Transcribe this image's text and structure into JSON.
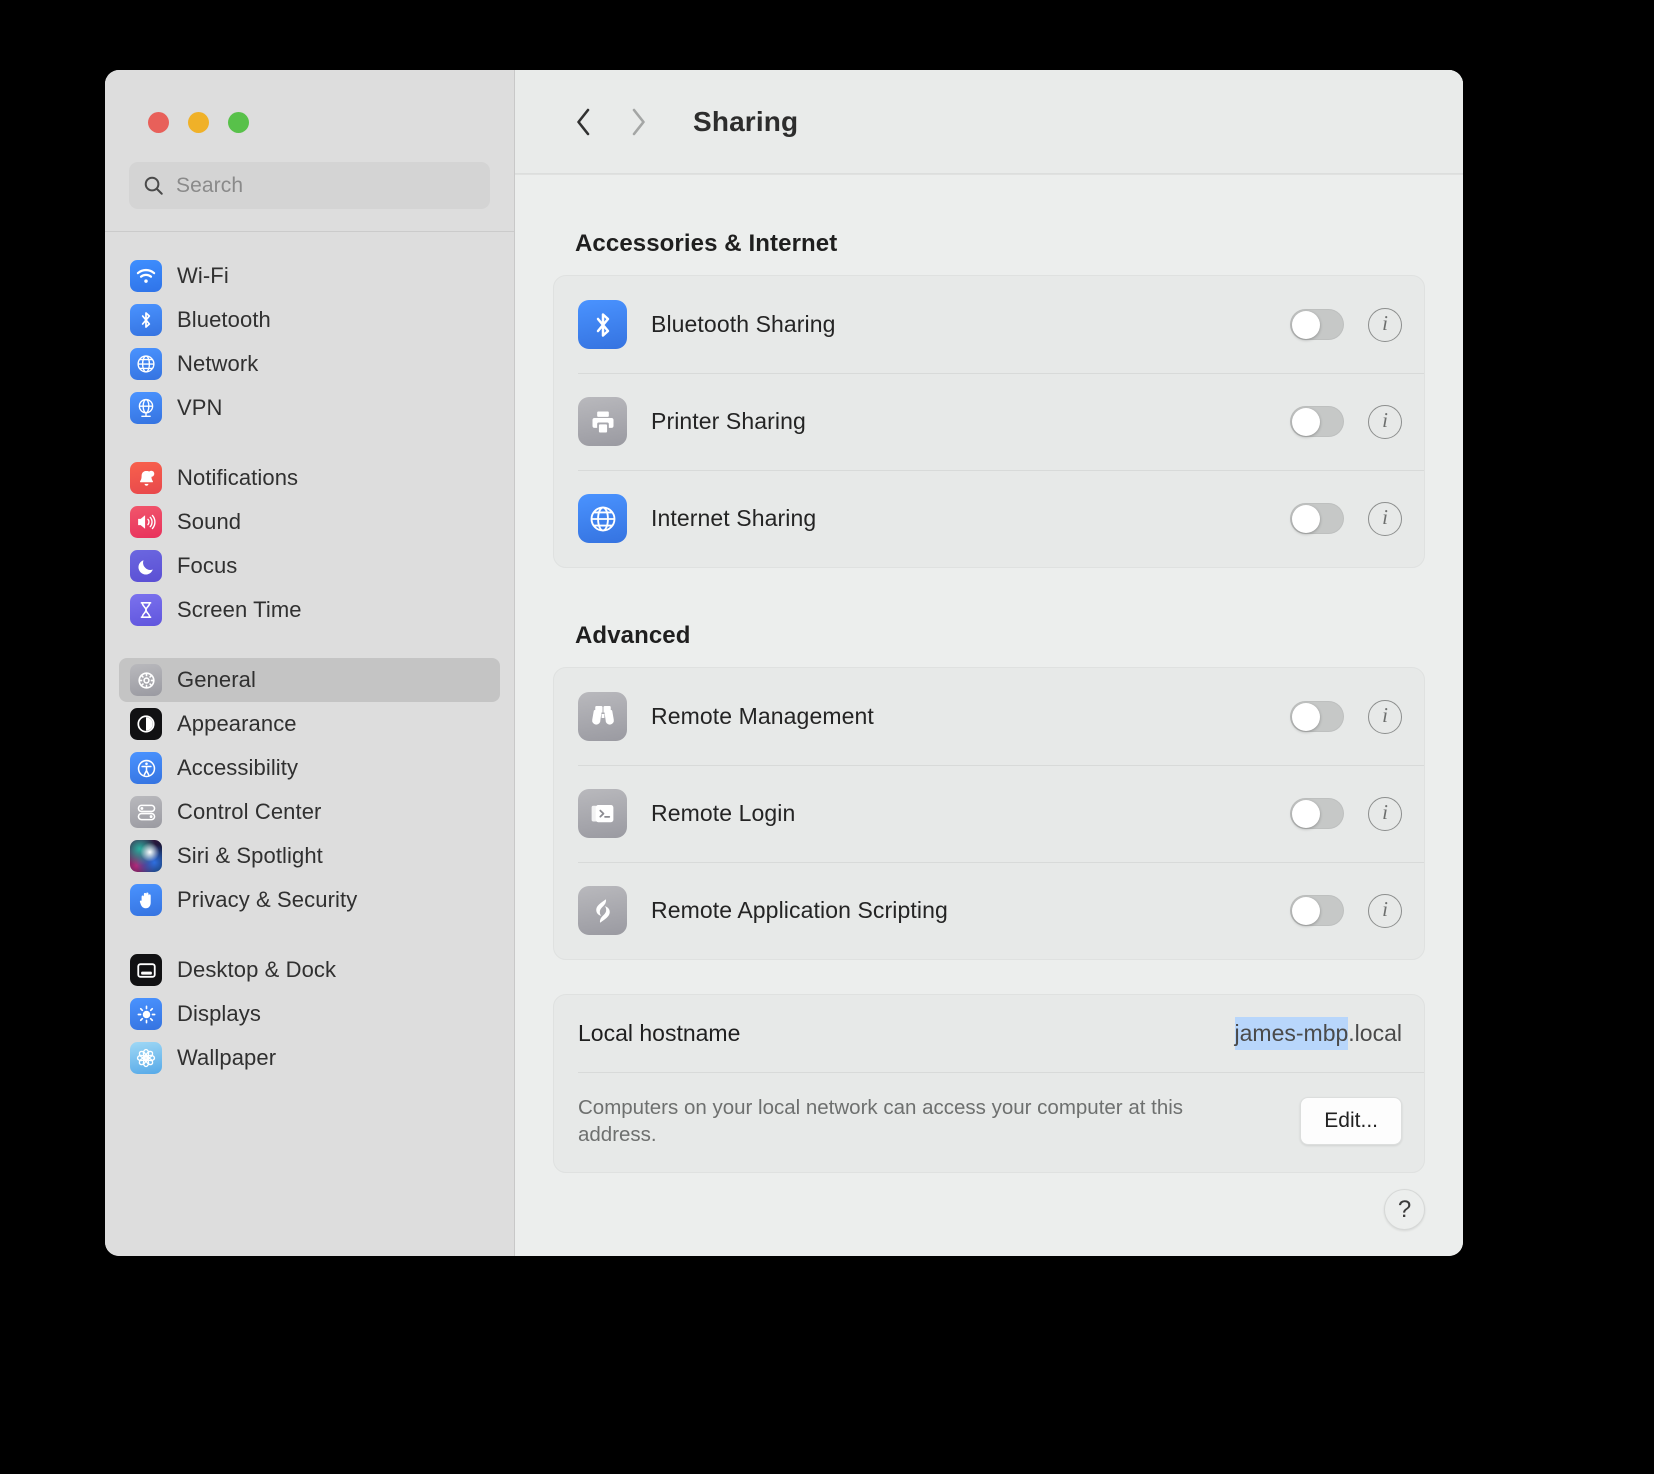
{
  "window": {
    "traffic_lights": [
      "close",
      "minimize",
      "maximize"
    ],
    "colors": {
      "close": "#e8605a",
      "minimize": "#f0b128",
      "maximize": "#58c14a",
      "selection_highlight": "#b8d6fb",
      "sidebar_bg": "#dddddd",
      "content_bg": "#eceeed",
      "accent_blue": "#3e8fff"
    }
  },
  "search": {
    "placeholder": "Search",
    "value": "",
    "icon": "search-icon"
  },
  "sidebar": {
    "groups": [
      {
        "items": [
          {
            "label": "Wi-Fi",
            "icon": "wifi-icon",
            "selected": false
          },
          {
            "label": "Bluetooth",
            "icon": "bluetooth-icon",
            "selected": false
          },
          {
            "label": "Network",
            "icon": "globe-icon",
            "selected": false
          },
          {
            "label": "VPN",
            "icon": "vpn-globe-icon",
            "selected": false
          }
        ]
      },
      {
        "items": [
          {
            "label": "Notifications",
            "icon": "bell-icon",
            "selected": false
          },
          {
            "label": "Sound",
            "icon": "speaker-icon",
            "selected": false
          },
          {
            "label": "Focus",
            "icon": "moon-icon",
            "selected": false
          },
          {
            "label": "Screen Time",
            "icon": "hourglass-icon",
            "selected": false
          }
        ]
      },
      {
        "items": [
          {
            "label": "General",
            "icon": "gear-icon",
            "selected": true
          },
          {
            "label": "Appearance",
            "icon": "appearance-icon",
            "selected": false
          },
          {
            "label": "Accessibility",
            "icon": "accessibility-icon",
            "selected": false
          },
          {
            "label": "Control Center",
            "icon": "control-center-icon",
            "selected": false
          },
          {
            "label": "Siri & Spotlight",
            "icon": "siri-icon",
            "selected": false
          },
          {
            "label": "Privacy & Security",
            "icon": "hand-icon",
            "selected": false
          }
        ]
      },
      {
        "items": [
          {
            "label": "Desktop & Dock",
            "icon": "desktop-dock-icon",
            "selected": false
          },
          {
            "label": "Displays",
            "icon": "brightness-icon",
            "selected": false
          },
          {
            "label": "Wallpaper",
            "icon": "wallpaper-icon",
            "selected": false
          }
        ]
      }
    ]
  },
  "toolbar": {
    "back_icon": "chevron-left-icon",
    "forward_icon": "chevron-right-icon",
    "title": "Sharing"
  },
  "main": {
    "sections": [
      {
        "title": "Accessories & Internet",
        "rows": [
          {
            "label": "Bluetooth Sharing",
            "icon": "bluetooth-icon",
            "icon_style": "blue",
            "toggle": "off",
            "info": "i"
          },
          {
            "label": "Printer Sharing",
            "icon": "printer-icon",
            "icon_style": "gray",
            "toggle": "off",
            "info": "i"
          },
          {
            "label": "Internet Sharing",
            "icon": "globe-icon",
            "icon_style": "blue",
            "toggle": "off",
            "info": "i"
          }
        ]
      },
      {
        "title": "Advanced",
        "rows": [
          {
            "label": "Remote Management",
            "icon": "binoculars-icon",
            "icon_style": "gray",
            "toggle": "off",
            "info": "i"
          },
          {
            "label": "Remote Login",
            "icon": "terminal-icon",
            "icon_style": "gray",
            "toggle": "off",
            "info": "i"
          },
          {
            "label": "Remote Application Scripting",
            "icon": "script-icon",
            "icon_style": "gray",
            "toggle": "off",
            "info": "i"
          }
        ]
      }
    ],
    "hostname": {
      "label": "Local hostname",
      "value_selected": "james-mbp",
      "value_rest": ".local",
      "description": "Computers on your local network can access your computer at this address.",
      "edit_label": "Edit..."
    },
    "help_label": "?"
  }
}
